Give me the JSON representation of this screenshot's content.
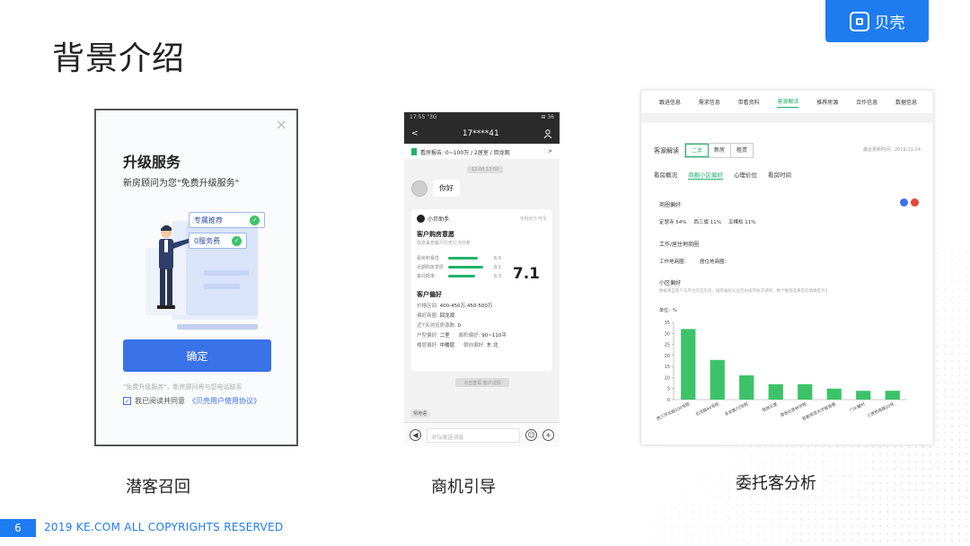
{
  "slide": {
    "title": "背景介绍",
    "logo_text": "贝壳",
    "page_number": "6",
    "copyright": "2019 KE.COM ALL COPYRIGHTS  RESERVED"
  },
  "captions": [
    "潜客召回",
    "商机引导",
    "委托客分析"
  ],
  "panel1": {
    "close": "×",
    "title": "升级服务",
    "subtitle": "新房顾问为您\"免费升级服务\"",
    "card_label1": "专属推荐",
    "card_label2": "0服务费",
    "confirm_button": "确定",
    "note": "\"免费升级服务\"，新房顾问将与您电话联系",
    "agree_prefix": "我已阅读并同意",
    "agree_link": "《贝壳用户使用协议》"
  },
  "panel2": {
    "status_time": "17:55 \"3G",
    "status_right": "⊞ 36",
    "nav_back": "<",
    "nav_title": "17****41",
    "report_text": "看房报告: 0~100万 / 2居室 / 回龙观",
    "report_arrow": ">",
    "timestamp": "12:00 13:50",
    "hello": "你好",
    "assistant_name": "小贝助手",
    "assistant_right": "仅经纪人可见",
    "intent_title": "客户购房意愿",
    "intent_sub": "信息来自客户历史行为分析",
    "metrics": [
      {
        "label": "看房积极性",
        "value": "6.9",
        "fill": 0.69
      },
      {
        "label": "近期购房意愿",
        "value": "8.1",
        "fill": 0.81
      },
      {
        "label": "委托概率",
        "value": "6.3",
        "fill": 0.63
      }
    ],
    "score": "7.1",
    "pref_title": "客户偏好",
    "prefs": [
      {
        "label": "价格区间:",
        "value": "400-450万,450-500万"
      },
      {
        "label": "偏好商圈:",
        "value": "回龙观"
      },
      {
        "label": "近7天浏览房源数:",
        "value": "0"
      }
    ],
    "pref_pairs": [
      {
        "l1": "户型偏好:",
        "v1": "二室",
        "l2": "面积偏好:",
        "v2": "90~110平"
      },
      {
        "l1": "楼层偏好:",
        "v1": "中楼层",
        "l2": "朝向偏好:",
        "v2": "东 北"
      }
    ],
    "view_button": "点击查看 客户详情",
    "tag": "常用语",
    "input_placeholder": "对Ta发送消息",
    "voice_icon": "◀",
    "emoji_icon": "☺",
    "plus_icon": "+"
  },
  "panel3": {
    "tabs": [
      "跟进信息",
      "需求信息",
      "带看资料",
      "客源解读",
      "推荐房源",
      "合作信息",
      "数据信息"
    ],
    "active_tab": 3,
    "header_label": "客源解读",
    "seg": [
      "二手",
      "新房",
      "租赁"
    ],
    "updated": "最近更新时间：2019-11-14",
    "subtabs": [
      "看房概况",
      "商圈小区偏好",
      "心理价位",
      "看房时间"
    ],
    "active_subtab": 1,
    "biz_pref_title": "商圈偏好",
    "biz_prefs": [
      "定慧寺 54%",
      "西三旗 11%",
      "五棵松 11%"
    ],
    "work_title": "工作/居住地商圈",
    "work_vals": [
      "工作地商圈：",
      "居住地商圈："
    ],
    "comm_title": "小区偏好",
    "comm_desc": "数据来自客户与平台交互历史，推荐偏好从左至右排序依次递降，数个推荐选来是的请确定为3",
    "unit": "单位：%",
    "badge_colors": [
      "#3a72e8",
      "#e8443a"
    ]
  },
  "chart_data": {
    "type": "bar",
    "categories": [
      "西三环北路100号院",
      "北洼路44号院",
      "永定路70号院",
      "翠微北里",
      "誉苍石景林学院",
      "首都师范大学宿舍楼",
      "门头馨村",
      "三虎桥南路10号"
    ],
    "values": [
      32,
      18,
      11,
      7,
      7,
      5,
      4,
      4
    ],
    "ylim": [
      0,
      35
    ],
    "yticks": [
      "0",
      "5",
      "10",
      "15",
      "20",
      "25",
      "30",
      "35"
    ],
    "color": "#3cc36a",
    "xlabel": "",
    "ylabel": "",
    "title": ""
  }
}
